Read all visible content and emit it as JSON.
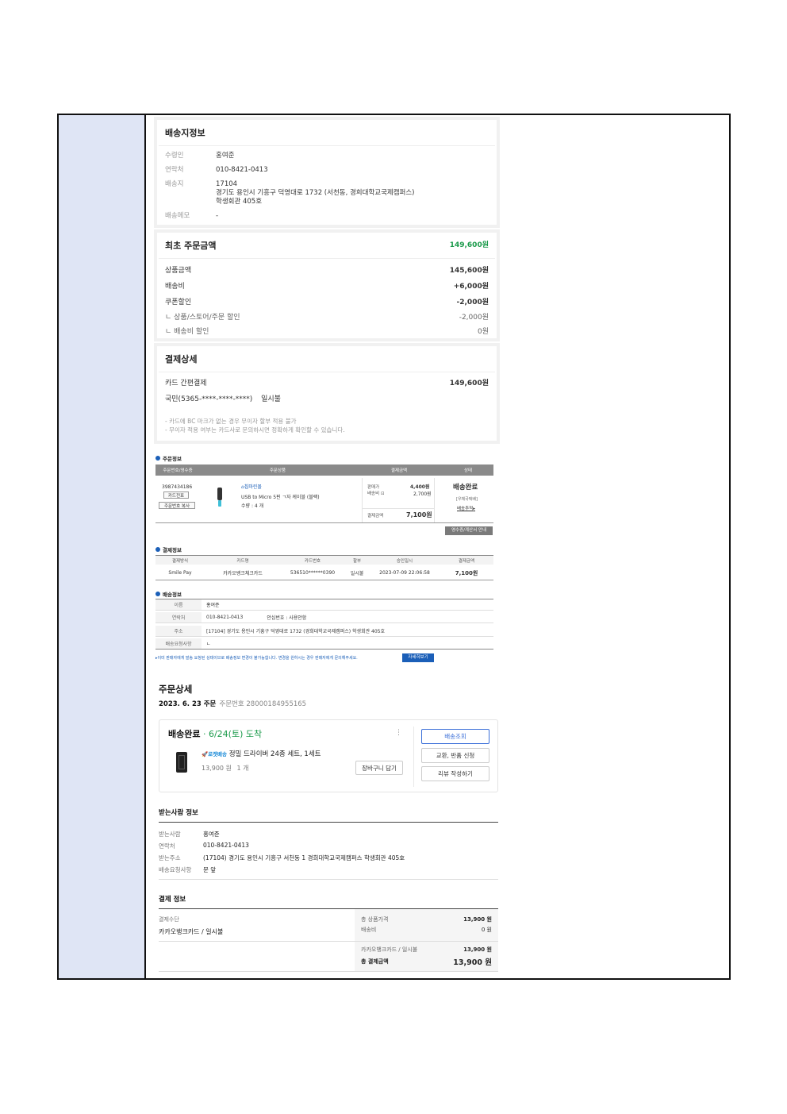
{
  "shipping_card": {
    "title": "배송지정보",
    "rows": [
      {
        "label": "수령인",
        "value": "홍여준"
      },
      {
        "label": "연락처",
        "value": "010-8421-0413"
      },
      {
        "label": "배송지",
        "lines": [
          "17104",
          "경기도 용인시 기흥구 덕영대로 1732 (서천동, 경희대학교국제캠퍼스)",
          "학생회관 405호"
        ]
      },
      {
        "label": "배송메모",
        "value": "-"
      }
    ]
  },
  "amount_card": {
    "title": "최초 주문금액",
    "total": "149,600원",
    "rows": [
      {
        "label": "상품금액",
        "value": "145,600원"
      },
      {
        "label": "배송비",
        "value": "+6,000원"
      },
      {
        "label": "쿠폰할인",
        "value": "-2,000원"
      },
      {
        "label": "ㄴ 상품/스토어/주문 할인",
        "value": "-2,000원"
      },
      {
        "label": "ㄴ 배송비 할인",
        "value": "0원"
      }
    ]
  },
  "payment_card": {
    "title": "결제상세",
    "method": "카드 간편결제",
    "amount": "149,600원",
    "card": "국민(5365-****-****-****)",
    "installment": "일시불",
    "notes": [
      "- 카드에 BC 마크가 없는 경우 무이자 할부 적용 불가",
      "- 무이자 적용 여부는 카드사로 문의하시면 정확하게 확인할 수 있습니다."
    ]
  },
  "order_info": {
    "title": "주문정보",
    "headers": [
      "주문번호/영수증",
      "주문상품",
      "결제금액",
      "상태"
    ],
    "order_no": "3987434186",
    "btn_receipt": "카드전표",
    "btn_copy": "주문번호 복사",
    "seller": "칩마린몰",
    "product": "USB to Micro 5핀 ㄱ자 케이블 (블랙)",
    "qty": "수량 : 4 개",
    "price_label": "판매가",
    "price": "4,400원",
    "ship_label": "배송비",
    "ship": "2,700원",
    "paid_label": "결제금액",
    "paid": "7,100원",
    "status": "배송완료",
    "status_sub": "[우체국택배]",
    "track": "배송추적",
    "receipt_btn": "영수증/계산서 안내"
  },
  "payment_info": {
    "title": "결제정보",
    "headers": [
      "결제방식",
      "카드명",
      "카드번호",
      "할부",
      "승인일시",
      "결제금액"
    ],
    "values": [
      "Smile Pay",
      "카카오뱅크체크카드",
      "536510******0390",
      "일시불",
      "2023-07-09 22:06:58",
      "7,100원"
    ]
  },
  "delivery_info": {
    "title": "배송정보",
    "rows": [
      {
        "k": "이름",
        "v": "홍여준"
      },
      {
        "k": "연락처",
        "v": "010-8421-0413",
        "extra": "안심번호 : 사용안함"
      },
      {
        "k": "주소",
        "v": "[17104] 경기도 용인시 기흥구 덕영대로 1732 (경희대학교국제캠퍼스) 학생회관 405호"
      },
      {
        "k": "배송요청사항",
        "v": "ㄴ"
      }
    ],
    "notice": "▸이미 판매자에게 발송 요청된 상태이므로 배송정보 변경이 불가능합니다. 변경을 원하시는 경우 판매자에게 문의해주세요.",
    "detail_btn": "자세히보기"
  },
  "order_detail": {
    "title": "주문상세",
    "date": "2023. 6. 23 주문",
    "order_no": "주문번호 28000184955165",
    "status": "배송완료",
    "arrival": "· 6/24(토) 도착",
    "badge": "로켓배송",
    "product": "정밀 드라이버 24종 세트, 1세트",
    "price": "13,900 원",
    "qty": "1 개",
    "cart_btn": "장바구니 담기",
    "btns": [
      "배송조회",
      "교환, 반품 신청",
      "리뷰 작성하기"
    ],
    "more": "⋮"
  },
  "receiver": {
    "title": "받는사람 정보",
    "rows": [
      {
        "k": "받는사람",
        "v": "홍여준"
      },
      {
        "k": "연락처",
        "v": "010-8421-0413"
      },
      {
        "k": "받는주소",
        "v": "(17104) 경기도 용인시 기흥구 서천동 1 경희대학교국제캠퍼스 학생회관 405호"
      },
      {
        "k": "배송요청사항",
        "v": "문 앞"
      }
    ]
  },
  "pay_info": {
    "title": "결제 정보",
    "method_label": "결제수단",
    "method": "카카오뱅크카드 / 일시불",
    "rows": [
      {
        "k": "총 상품가격",
        "v": "13,900 원"
      },
      {
        "k": "배송비",
        "v": "0 원"
      },
      {
        "k": "카카오뱅크카드 / 일시불",
        "v": "13,900 원"
      },
      {
        "k": "총 결제금액",
        "v": "13,900 원"
      }
    ]
  },
  "colors": {
    "accent_green": "#1a9a4a",
    "blue": "#1b5fb8",
    "left_panel": "#dfe5f5"
  }
}
